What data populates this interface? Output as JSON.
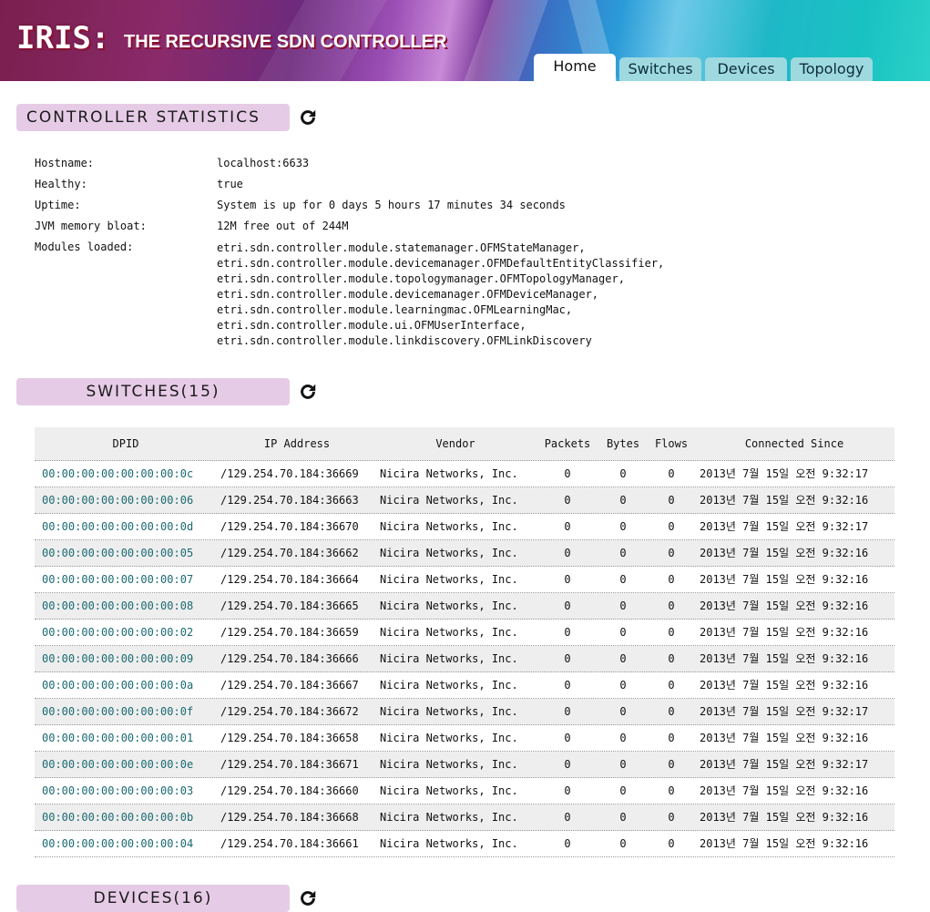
{
  "header": {
    "logo": "IRIS:",
    "subtitle": "THE RECURSIVE SDN CONTROLLER",
    "tabs": [
      {
        "label": "Home",
        "active": true
      },
      {
        "label": "Switches",
        "active": false
      },
      {
        "label": "Devices",
        "active": false
      },
      {
        "label": "Topology",
        "active": false
      }
    ]
  },
  "controller_stats": {
    "heading": "CONTROLLER STATISTICS",
    "refresh_icon": "refresh-icon",
    "rows": [
      {
        "label": "Hostname:",
        "value": "localhost:6633"
      },
      {
        "label": "Healthy:",
        "value": "true"
      },
      {
        "label": "Uptime:",
        "value": "System is up for 0 days 5 hours 17 minutes 34 seconds"
      },
      {
        "label": "JVM memory bloat:",
        "value": "12M free out of 244M"
      }
    ],
    "modules_label": "Modules loaded:",
    "modules": [
      "etri.sdn.controller.module.statemanager.OFMStateManager,",
      "etri.sdn.controller.module.devicemanager.OFMDefaultEntityClassifier,",
      "etri.sdn.controller.module.topologymanager.OFMTopologyManager,",
      "etri.sdn.controller.module.devicemanager.OFMDeviceManager,",
      "etri.sdn.controller.module.learningmac.OFMLearningMac,",
      "etri.sdn.controller.module.ui.OFMUserInterface,",
      "etri.sdn.controller.module.linkdiscovery.OFMLinkDiscovery"
    ]
  },
  "switches": {
    "heading": "SWITCHES(15)",
    "columns": [
      "DPID",
      "IP Address",
      "Vendor",
      "Packets",
      "Bytes",
      "Flows",
      "Connected Since"
    ],
    "rows": [
      [
        "00:00:00:00:00:00:00:0c",
        "/129.254.70.184:36669",
        "Nicira Networks, Inc.",
        "0",
        "0",
        "0",
        "2013년 7월 15일 오전 9:32:17"
      ],
      [
        "00:00:00:00:00:00:00:06",
        "/129.254.70.184:36663",
        "Nicira Networks, Inc.",
        "0",
        "0",
        "0",
        "2013년 7월 15일 오전 9:32:16"
      ],
      [
        "00:00:00:00:00:00:00:0d",
        "/129.254.70.184:36670",
        "Nicira Networks, Inc.",
        "0",
        "0",
        "0",
        "2013년 7월 15일 오전 9:32:17"
      ],
      [
        "00:00:00:00:00:00:00:05",
        "/129.254.70.184:36662",
        "Nicira Networks, Inc.",
        "0",
        "0",
        "0",
        "2013년 7월 15일 오전 9:32:16"
      ],
      [
        "00:00:00:00:00:00:00:07",
        "/129.254.70.184:36664",
        "Nicira Networks, Inc.",
        "0",
        "0",
        "0",
        "2013년 7월 15일 오전 9:32:16"
      ],
      [
        "00:00:00:00:00:00:00:08",
        "/129.254.70.184:36665",
        "Nicira Networks, Inc.",
        "0",
        "0",
        "0",
        "2013년 7월 15일 오전 9:32:16"
      ],
      [
        "00:00:00:00:00:00:00:02",
        "/129.254.70.184:36659",
        "Nicira Networks, Inc.",
        "0",
        "0",
        "0",
        "2013년 7월 15일 오전 9:32:16"
      ],
      [
        "00:00:00:00:00:00:00:09",
        "/129.254.70.184:36666",
        "Nicira Networks, Inc.",
        "0",
        "0",
        "0",
        "2013년 7월 15일 오전 9:32:16"
      ],
      [
        "00:00:00:00:00:00:00:0a",
        "/129.254.70.184:36667",
        "Nicira Networks, Inc.",
        "0",
        "0",
        "0",
        "2013년 7월 15일 오전 9:32:16"
      ],
      [
        "00:00:00:00:00:00:00:0f",
        "/129.254.70.184:36672",
        "Nicira Networks, Inc.",
        "0",
        "0",
        "0",
        "2013년 7월 15일 오전 9:32:17"
      ],
      [
        "00:00:00:00:00:00:00:01",
        "/129.254.70.184:36658",
        "Nicira Networks, Inc.",
        "0",
        "0",
        "0",
        "2013년 7월 15일 오전 9:32:16"
      ],
      [
        "00:00:00:00:00:00:00:0e",
        "/129.254.70.184:36671",
        "Nicira Networks, Inc.",
        "0",
        "0",
        "0",
        "2013년 7월 15일 오전 9:32:17"
      ],
      [
        "00:00:00:00:00:00:00:03",
        "/129.254.70.184:36660",
        "Nicira Networks, Inc.",
        "0",
        "0",
        "0",
        "2013년 7월 15일 오전 9:32:16"
      ],
      [
        "00:00:00:00:00:00:00:0b",
        "/129.254.70.184:36668",
        "Nicira Networks, Inc.",
        "0",
        "0",
        "0",
        "2013년 7월 15일 오전 9:32:16"
      ],
      [
        "00:00:00:00:00:00:00:04",
        "/129.254.70.184:36661",
        "Nicira Networks, Inc.",
        "0",
        "0",
        "0",
        "2013년 7월 15일 오전 9:32:16"
      ]
    ]
  },
  "devices": {
    "heading": "DEVICES(16)"
  },
  "colors": {
    "section_bg": "#e6cbe6",
    "tab_bg": "#9fd9e0",
    "dpid_link": "#1b6a72",
    "row_alt": "#eeeeee"
  }
}
